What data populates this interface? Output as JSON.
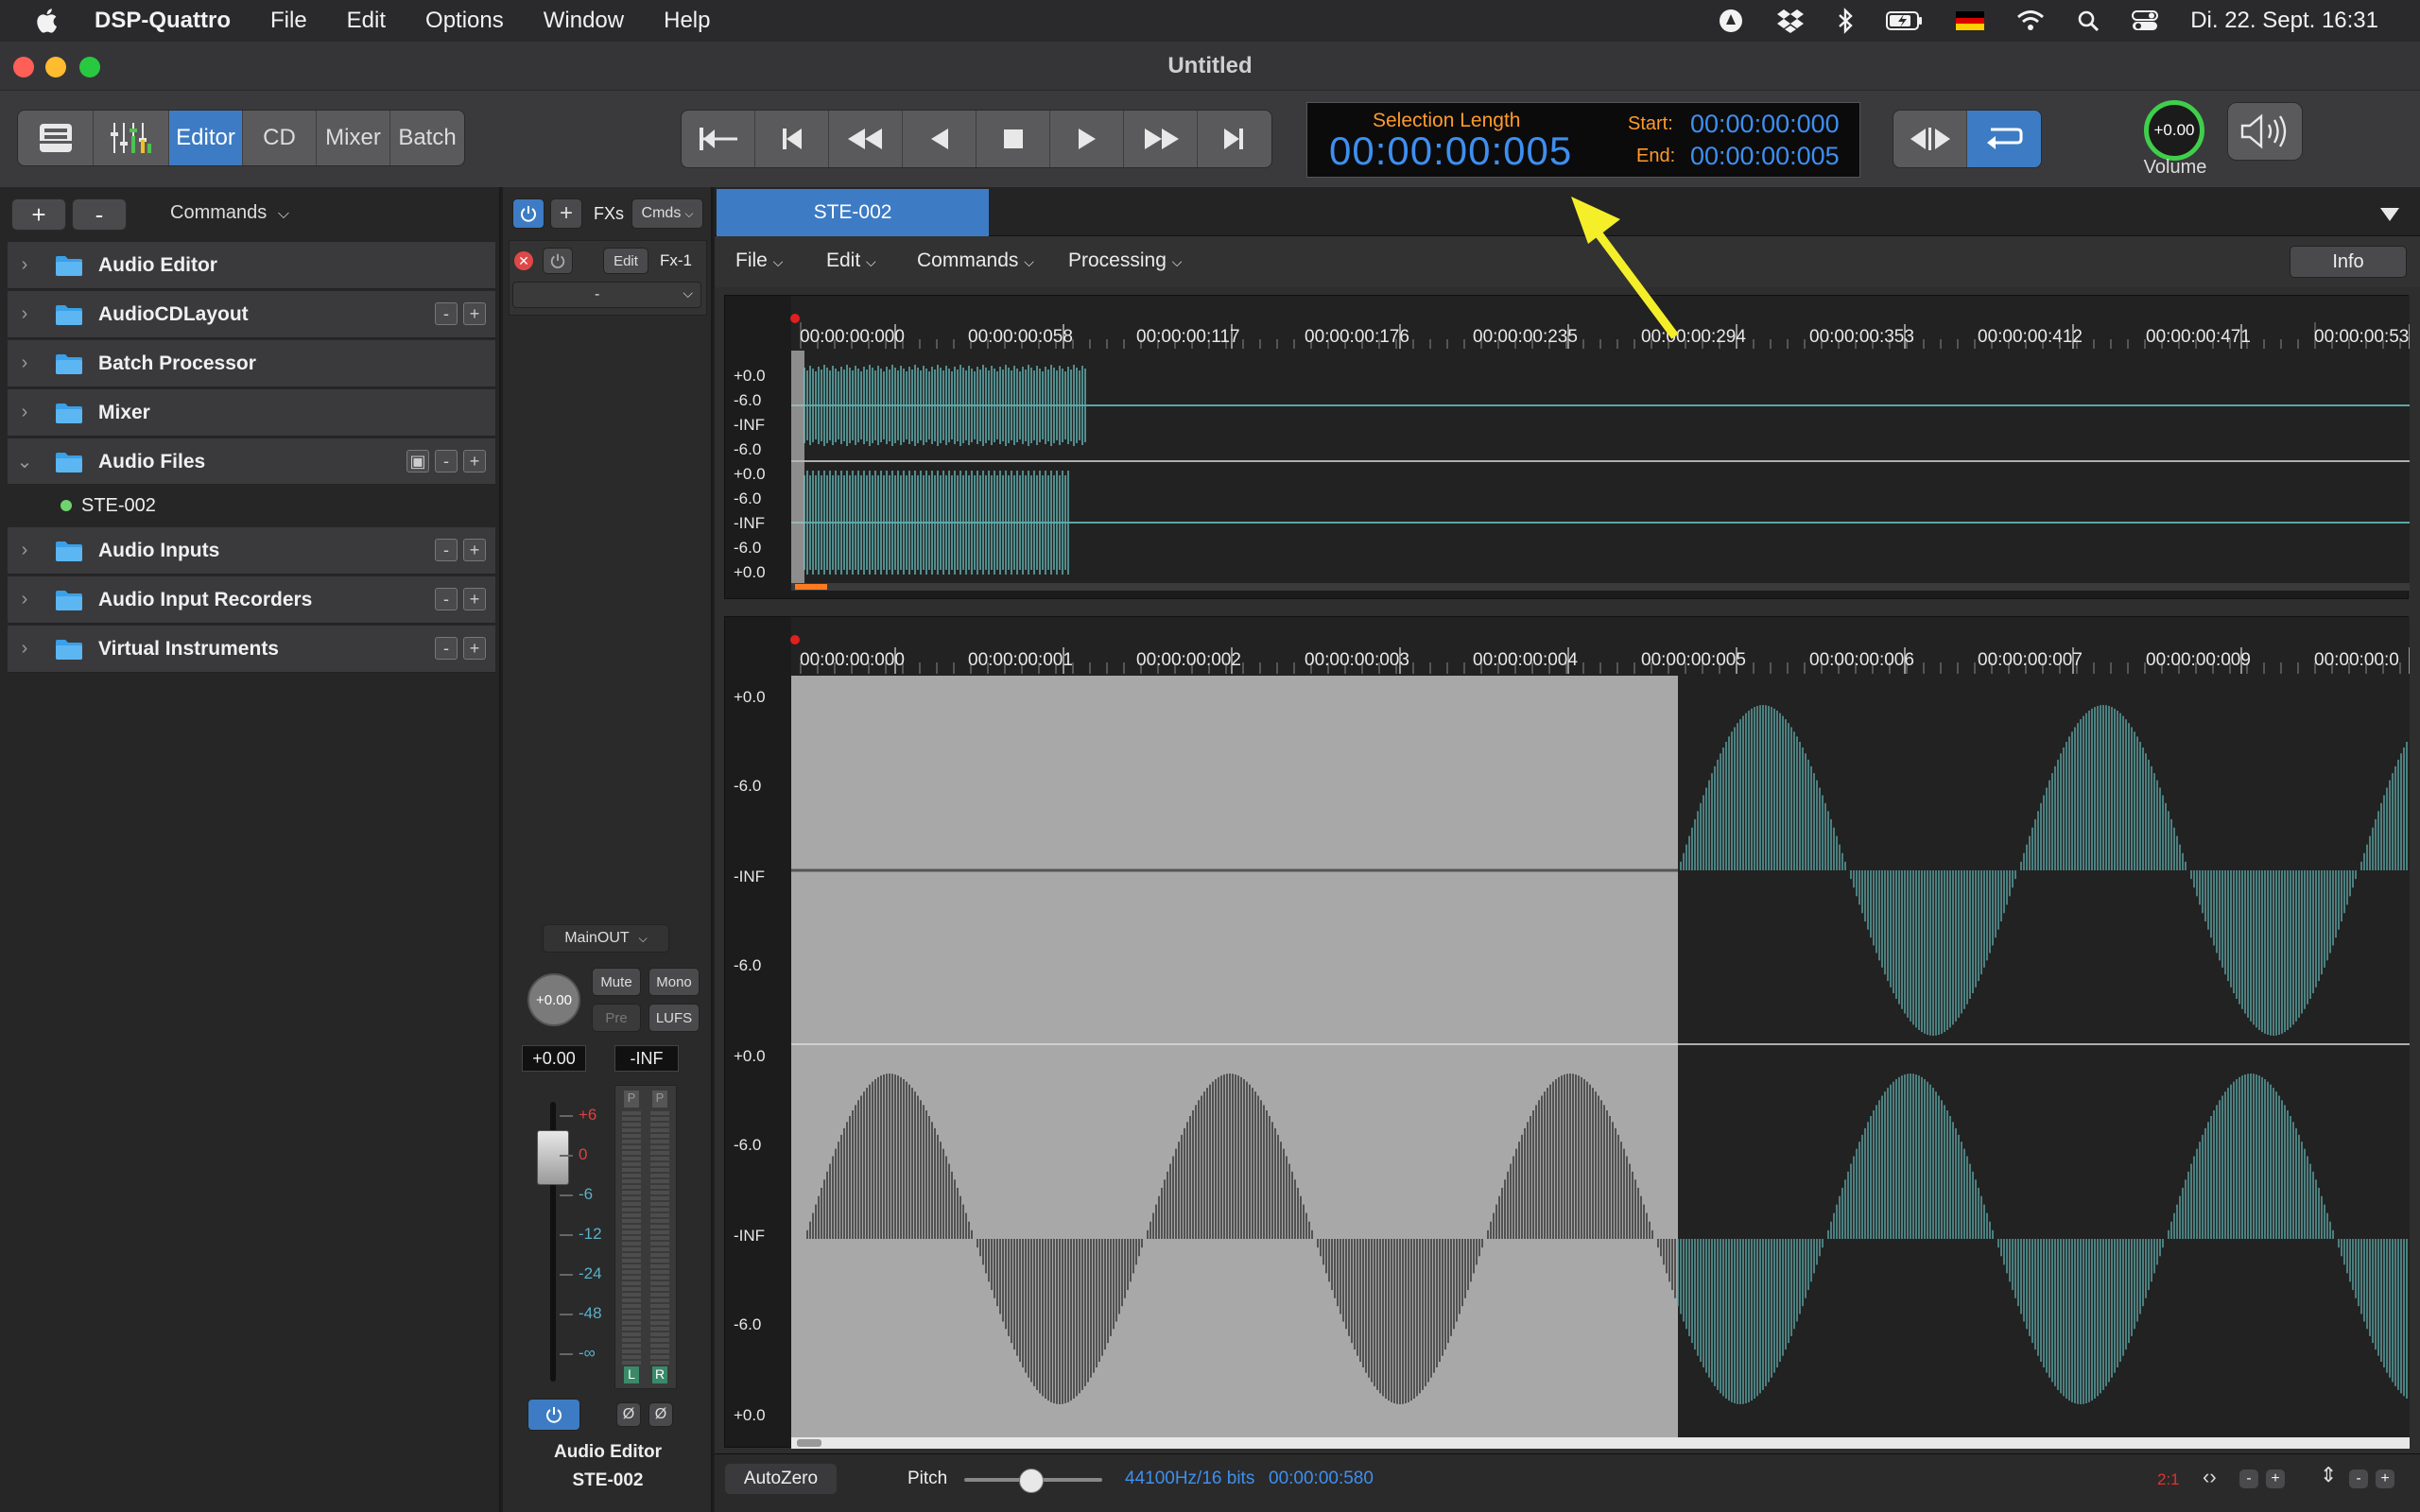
{
  "menubar": {
    "app": "DSP-Quattro",
    "items": [
      "File",
      "Edit",
      "Options",
      "Window",
      "Help"
    ],
    "clock": "Di. 22. Sept.  16:31",
    "status_icons": [
      "vpn-icon",
      "dropbox-icon",
      "bluetooth-icon",
      "battery-icon",
      "german-flag-icon",
      "wifi-icon",
      "spotlight-icon",
      "control-center-icon"
    ]
  },
  "window": {
    "title": "Untitled"
  },
  "toolbar": {
    "modes": [
      "Editor",
      "CD",
      "Mixer",
      "Batch"
    ],
    "active_mode": "Editor",
    "transport": [
      "skip-to-start-icon",
      "previous-marker-icon",
      "rewind-icon",
      "play-reverse-icon",
      "stop-icon",
      "play-icon",
      "fast-forward-icon",
      "skip-to-end-icon"
    ],
    "selection_length_label": "Selection Length",
    "selection_length": "00:00:00:005",
    "start_label": "Start:",
    "start_value": "00:00:00:000",
    "end_label": "End:",
    "end_value": "00:00:00:005",
    "volume_value": "+0.00",
    "volume_label": "Volume"
  },
  "left_panel": {
    "add": "+",
    "remove": "-",
    "commands": "Commands",
    "tree": [
      {
        "label": "Audio Editor",
        "expanded": false,
        "actions": false
      },
      {
        "label": "AudioCDLayout",
        "expanded": false,
        "actions": true
      },
      {
        "label": "Batch Processor",
        "expanded": false,
        "actions": false
      },
      {
        "label": "Mixer",
        "expanded": false,
        "actions": false
      },
      {
        "label": "Audio Files",
        "expanded": true,
        "actions": true
      },
      {
        "label": "Audio Inputs",
        "expanded": false,
        "actions": true
      },
      {
        "label": "Audio Input Recorders",
        "expanded": false,
        "actions": true
      },
      {
        "label": "Virtual Instruments",
        "expanded": false,
        "actions": true
      }
    ],
    "file_child": "STE-002"
  },
  "strip": {
    "fxs": "FXs",
    "cmds": "Cmds",
    "edit": "Edit",
    "fx_slot": "Fx-1",
    "insert_select": "-",
    "output": "MainOUT",
    "pan_value": "+0.00",
    "mute": "Mute",
    "mono": "Mono",
    "pre": "Pre",
    "lufs": "LUFS",
    "gain_value": "+0.00",
    "peak_value": "-INF",
    "meter_p": "P",
    "meter_l": "L",
    "meter_r": "R",
    "phase": "Ø",
    "scale": [
      "+6",
      "0",
      "-6",
      "-12",
      "-24",
      "-48",
      "-∞"
    ],
    "footer_title": "Audio Editor",
    "footer_file": "STE-002"
  },
  "editor": {
    "tab": "STE-002",
    "menus": [
      "File",
      "Edit",
      "Commands",
      "Processing"
    ],
    "info": "Info",
    "overview_ruler": [
      "00:00:00:000",
      "00:00:00:058",
      "00:00:00:117",
      "00:00:00:176",
      "00:00:00:235",
      "00:00:00:294",
      "00:00:00:353",
      "00:00:00:412",
      "00:00:00:471",
      "00:00:00:53"
    ],
    "overview_db": [
      "+0.0",
      "-6.0",
      "-INF",
      "-6.0",
      "+0.0",
      "-6.0",
      "-INF",
      "-6.0",
      "+0.0"
    ],
    "detail_ruler": [
      "00:00:00:000",
      "00:00:00:001",
      "00:00:00:002",
      "00:00:00:003",
      "00:00:00:004",
      "00:00:00:005",
      "00:00:00:006",
      "00:00:00:007",
      "00:00:00:009",
      "00:00:00:0"
    ],
    "detail_db": [
      "+0.0",
      "-6.0",
      "-INF",
      "-6.0",
      "+0.0",
      "-6.0",
      "-INF",
      "-6.0",
      "+0.0"
    ]
  },
  "status": {
    "autozero": "AutoZero",
    "pitch": "Pitch",
    "format": "44100Hz/16 bits",
    "duration": "00:00:00:580",
    "zoom": "2:1"
  }
}
